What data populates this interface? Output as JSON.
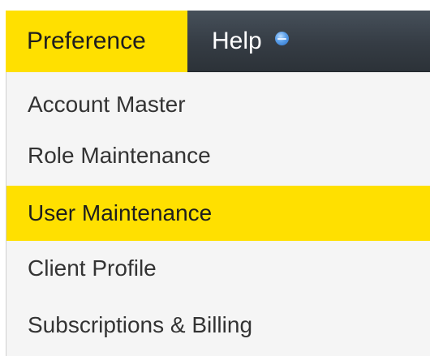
{
  "navbar": {
    "items": [
      {
        "label": "Preference",
        "active": true
      },
      {
        "label": "Help",
        "icon": "minus-circle-icon",
        "active": false
      }
    ]
  },
  "menu": {
    "items": [
      {
        "label": "Account Master",
        "active": false
      },
      {
        "label": "Role Maintenance",
        "active": false
      },
      {
        "label": "User Maintenance",
        "active": true
      },
      {
        "label": "Client Profile",
        "active": false
      },
      {
        "label": "Subscriptions & Billing",
        "active": false
      }
    ]
  },
  "colors": {
    "accent_yellow": "#ffe000",
    "navbar_dark": "#353c44",
    "menu_background": "#f5f5f5",
    "menu_text": "#333333",
    "help_icon_blue": "#5a9ee8"
  }
}
